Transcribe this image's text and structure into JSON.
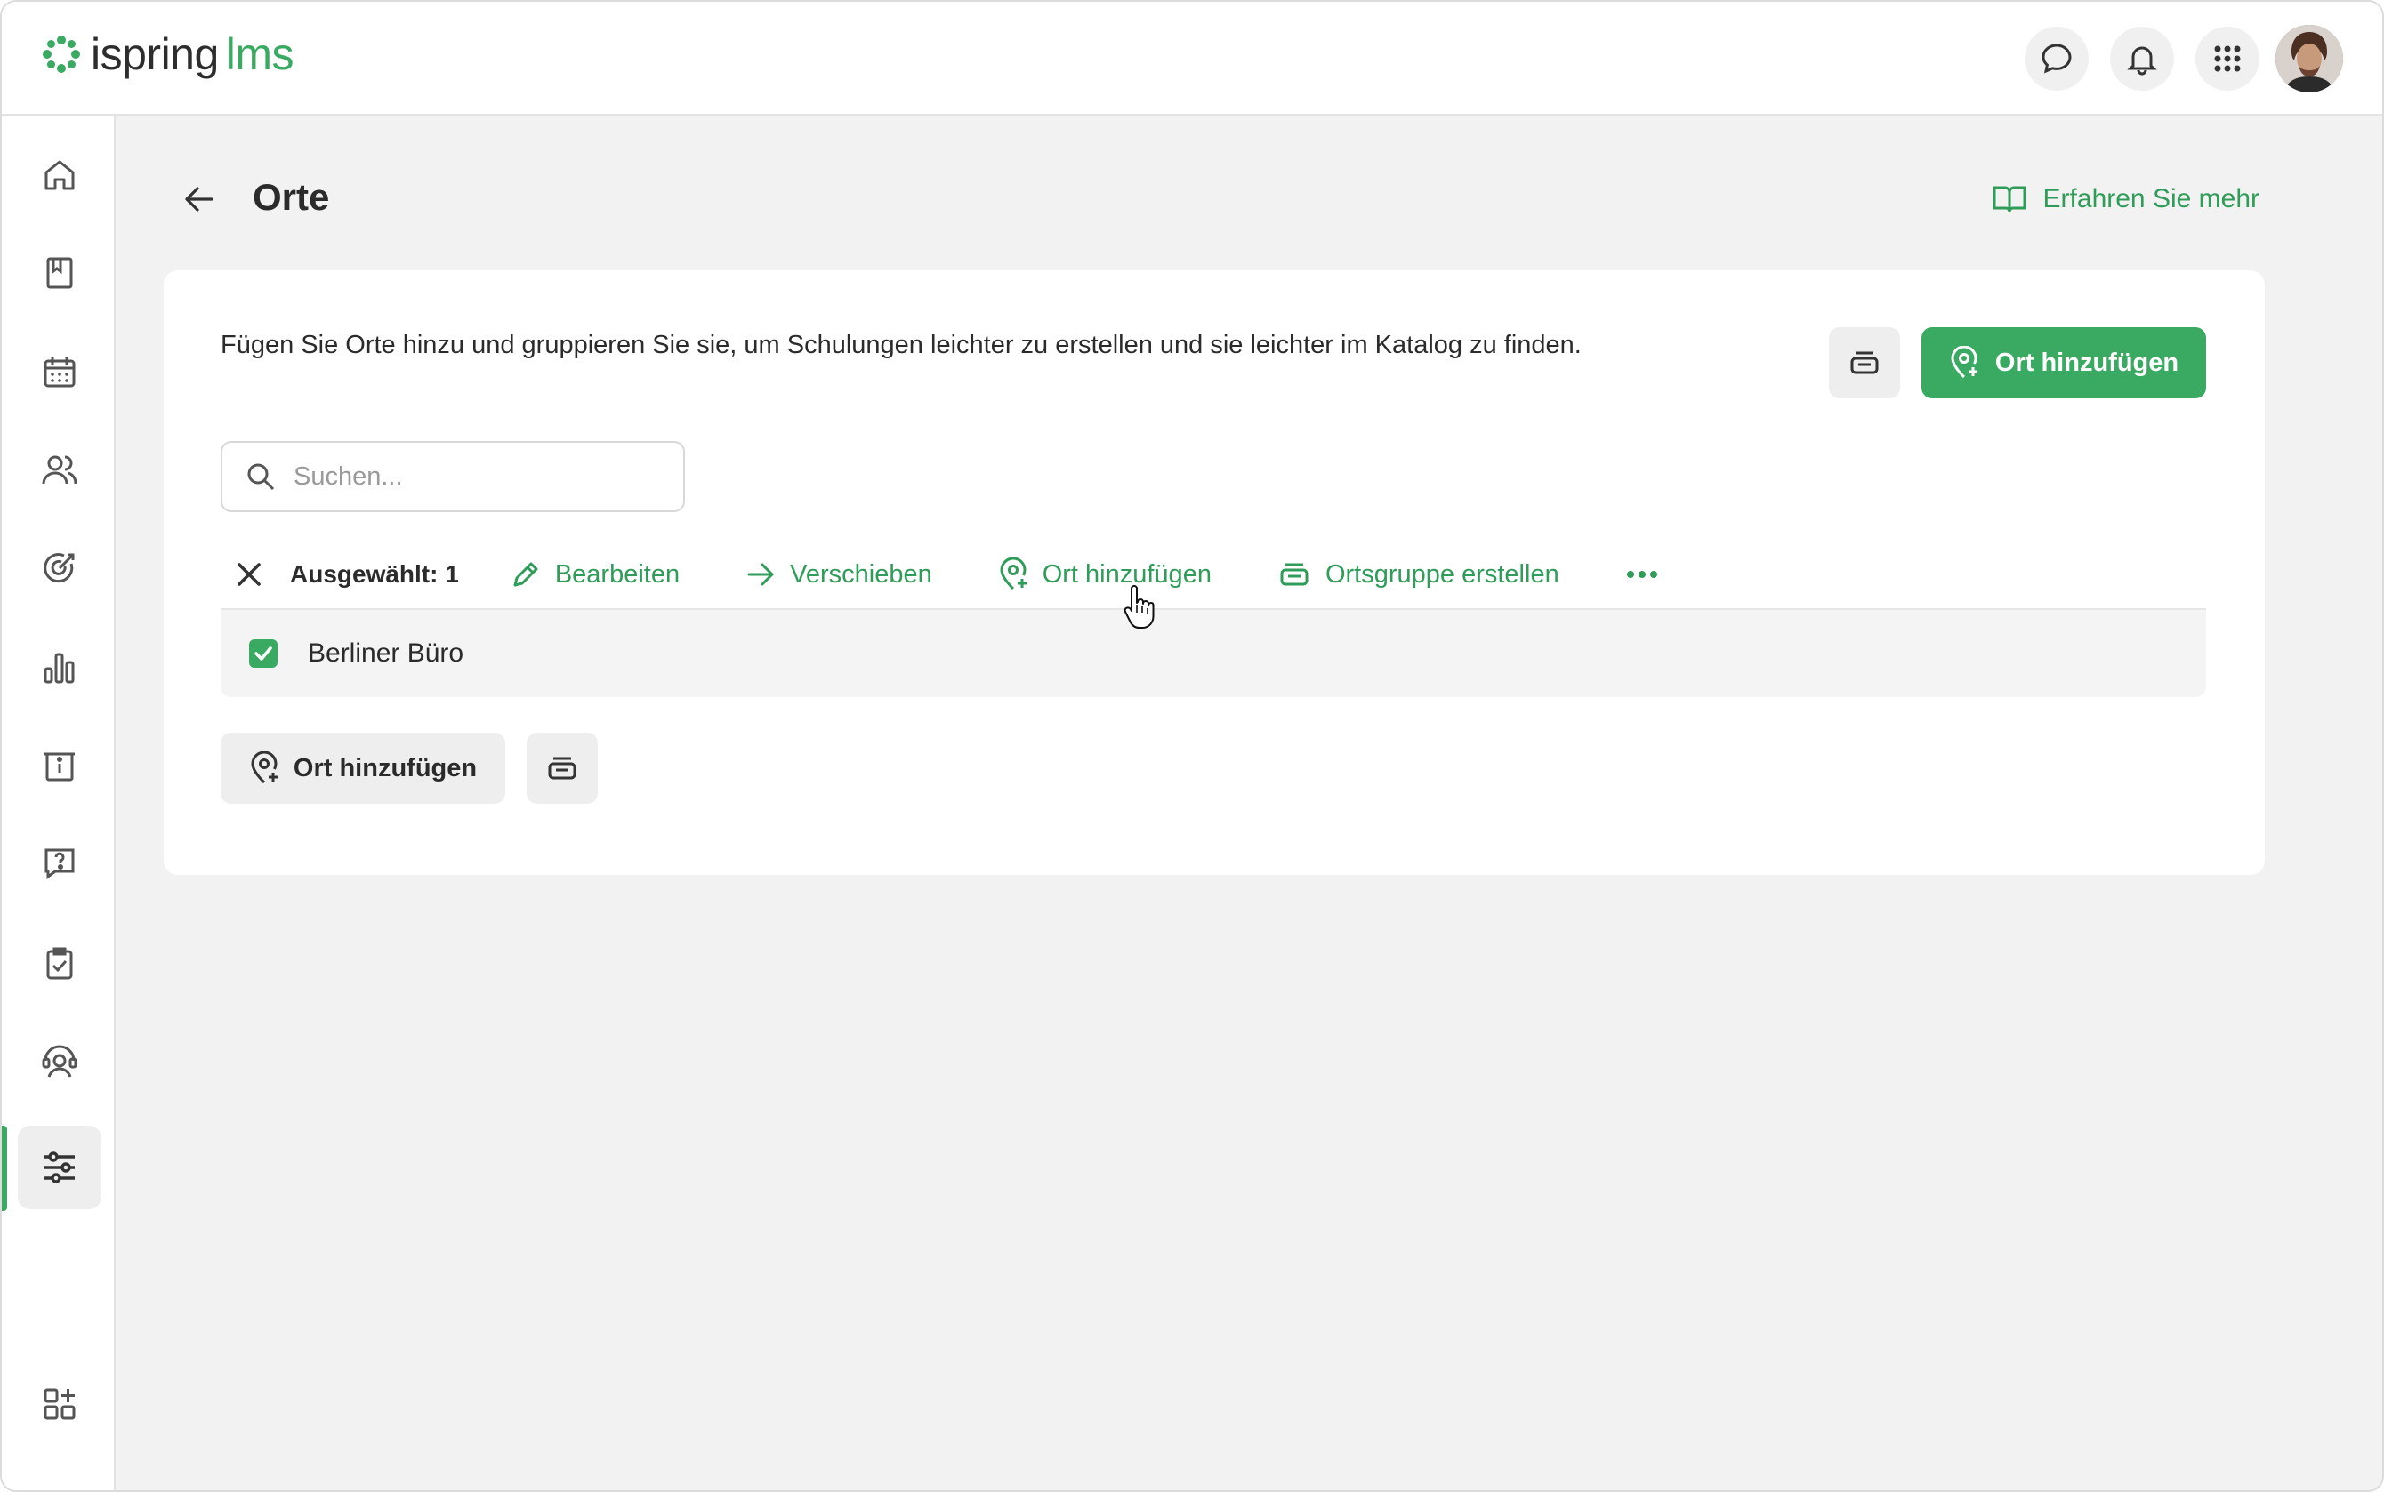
{
  "header": {
    "logo_text": "ispring",
    "logo_suffix": "lms",
    "brand_color": "#3aaa63",
    "icons": [
      "chat-icon",
      "bell-icon",
      "apps-grid-icon"
    ]
  },
  "sidebar": {
    "items": [
      {
        "name": "home"
      },
      {
        "name": "library"
      },
      {
        "name": "calendar"
      },
      {
        "name": "users"
      },
      {
        "name": "goals"
      },
      {
        "name": "reports"
      },
      {
        "name": "info"
      },
      {
        "name": "questions"
      },
      {
        "name": "tasks"
      },
      {
        "name": "support"
      },
      {
        "name": "settings",
        "active": true
      },
      {
        "name": "add-widgets"
      }
    ]
  },
  "page": {
    "title": "Orte",
    "learn_more": "Erfahren Sie mehr",
    "description": "Fügen Sie Orte hinzu und gruppieren Sie sie, um Schulungen leichter zu erstellen und sie leichter im Katalog zu finden.",
    "add_location": "Ort hinzufügen"
  },
  "search": {
    "placeholder": "Suchen..."
  },
  "toolbar": {
    "selected": "Ausgewählt: 1",
    "edit": "Bearbeiten",
    "move": "Verschieben",
    "add_location": "Ort hinzufügen",
    "create_group": "Ortsgruppe erstellen"
  },
  "rows": [
    {
      "label": "Berliner Büro",
      "checked": true
    }
  ],
  "footer": {
    "add_location": "Ort hinzufügen"
  }
}
